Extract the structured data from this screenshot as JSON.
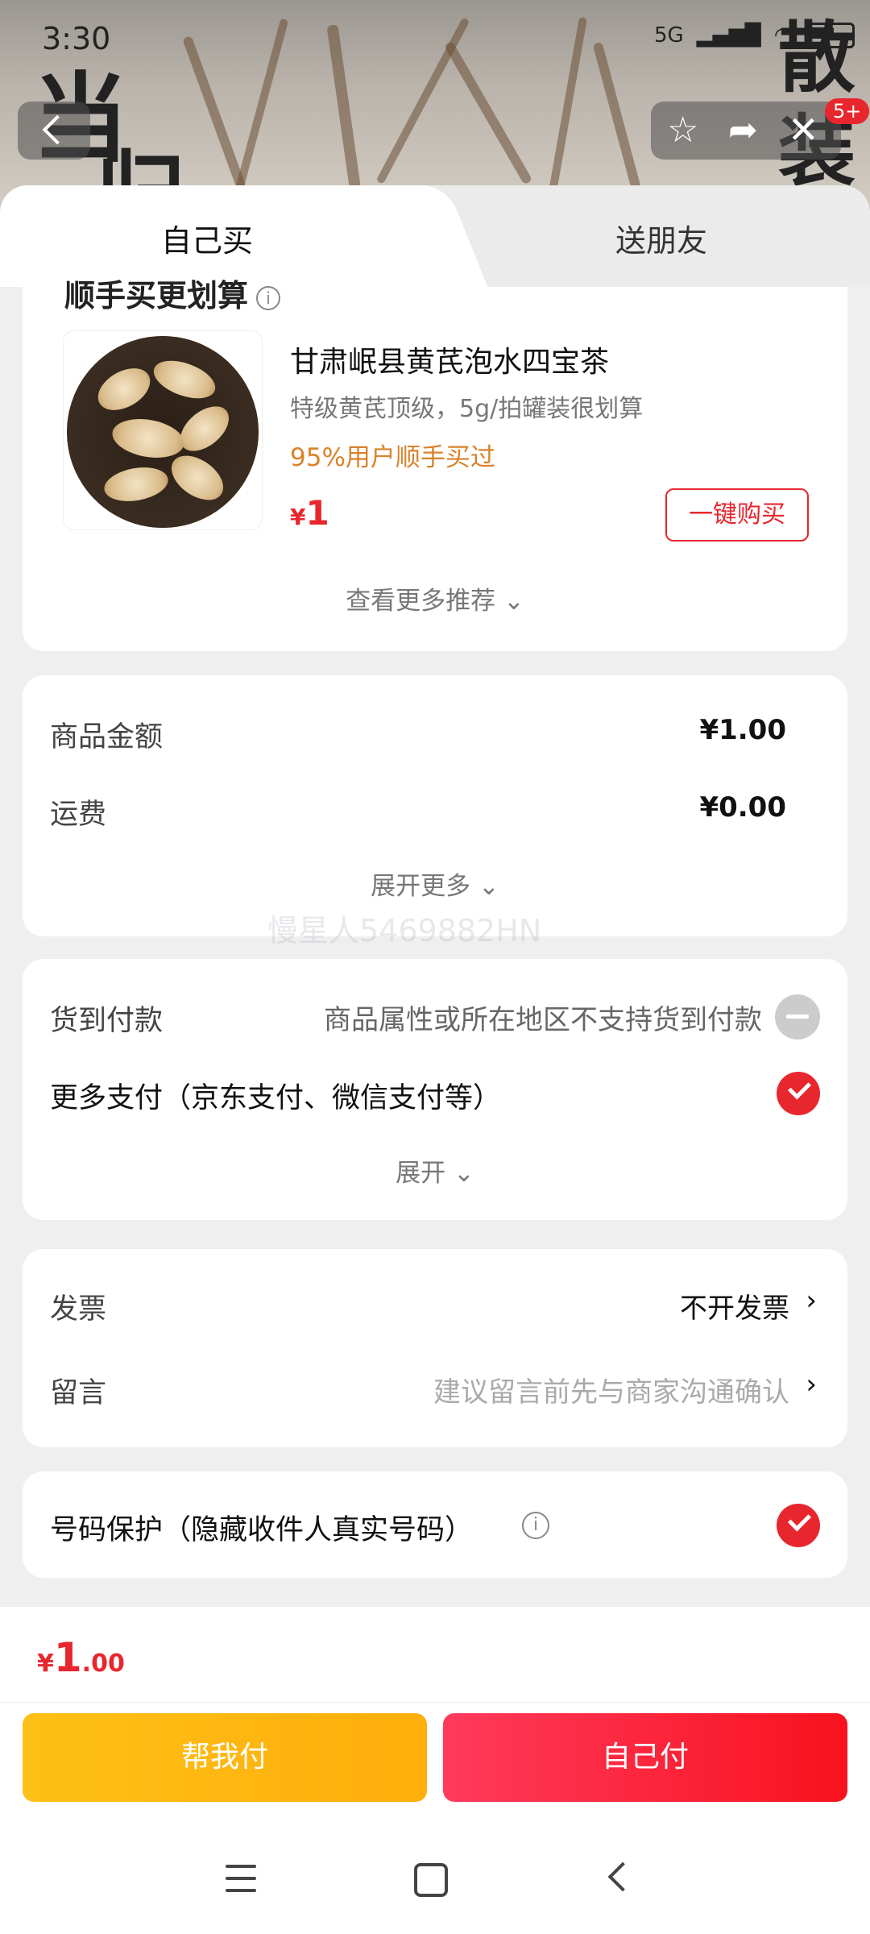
{
  "status_bar": {
    "time": "3:30",
    "network": "5G",
    "battery": ""
  },
  "header": {
    "background_text": [
      "当",
      "归",
      "散",
      "装"
    ],
    "cart_badge": "5+"
  },
  "tabs": [
    {
      "label": "自己买",
      "active": true
    },
    {
      "label": "送朋友",
      "active": false
    }
  ],
  "recommend": {
    "title": "顺手买更划算",
    "product": {
      "name": "甘肃岷县黄芪泡水四宝茶",
      "desc": "特级黄芪顶级，5g/拍罐装很划算",
      "bought": "95%用户顺手买过",
      "currency": "¥",
      "price": "1",
      "buy_label": "一键购买"
    },
    "more_label": "查看更多推荐 ⌄"
  },
  "amount": {
    "goods_label": "商品金额",
    "goods_value": "¥1.00",
    "shipping_label": "运费",
    "shipping_value": "¥0.00",
    "expand_label": "展开更多 ⌄"
  },
  "watermark": "慢星人5469882HN",
  "payment": {
    "cod_label": "货到付款",
    "cod_note": "商品属性或所在地区不支持货到付款",
    "more_pay_label": "更多支付（京东支付、微信支付等）",
    "expand_label": "展开 ⌄"
  },
  "invoice": {
    "invoice_label": "发票",
    "invoice_value": "不开发票",
    "message_label": "留言",
    "message_placeholder": "建议留言前先与商家沟通确认"
  },
  "privacy": {
    "label": "号码保护（隐藏收件人真实号码）"
  },
  "footer": {
    "currency": "¥",
    "total_int": "1",
    "total_dec": ".00",
    "help_pay": "帮我付",
    "self_pay": "自己付"
  },
  "colors": {
    "accent": "#e8262e",
    "orange": "#d9822b",
    "yellow": "#fdc017"
  }
}
